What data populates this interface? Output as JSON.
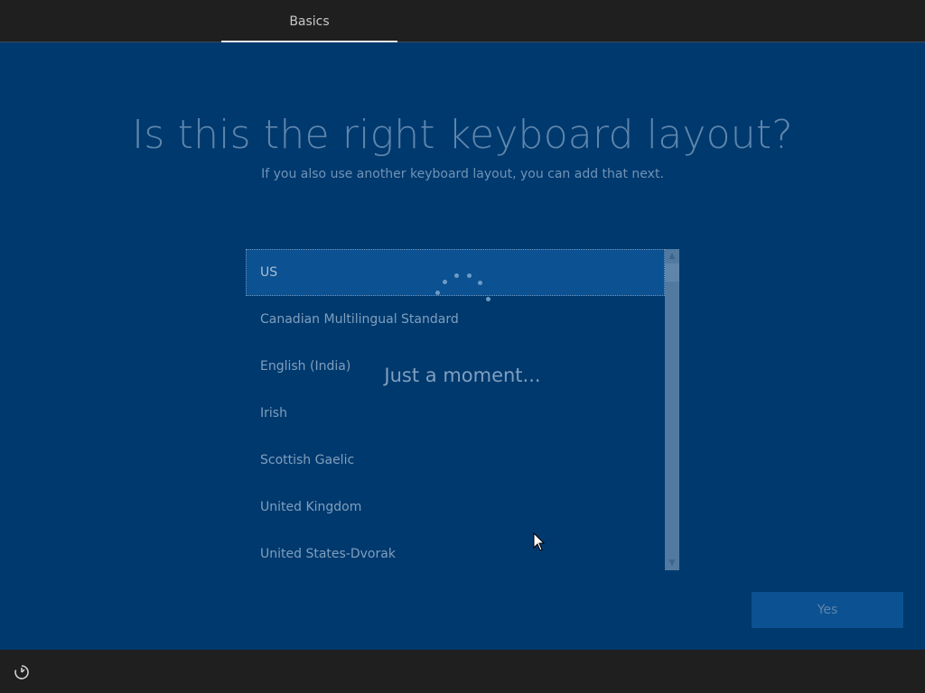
{
  "header": {
    "tab_label": "Basics"
  },
  "page": {
    "title": "Is this the right keyboard layout?",
    "subtitle": "If you also use another keyboard layout, you can add that next."
  },
  "layouts": {
    "items": [
      "US",
      "Canadian Multilingual Standard",
      "English (India)",
      "Irish",
      "Scottish Gaelic",
      "United Kingdom",
      "United States-Dvorak"
    ],
    "selected": "US"
  },
  "status": {
    "loading_text": "Just a moment..."
  },
  "footer": {
    "yes_label": "Yes",
    "ease_of_access_icon": "ease-of-access-icon"
  },
  "colors": {
    "background": "#00396e",
    "selection": "#0c5191",
    "bars": "#1f1f1f"
  }
}
